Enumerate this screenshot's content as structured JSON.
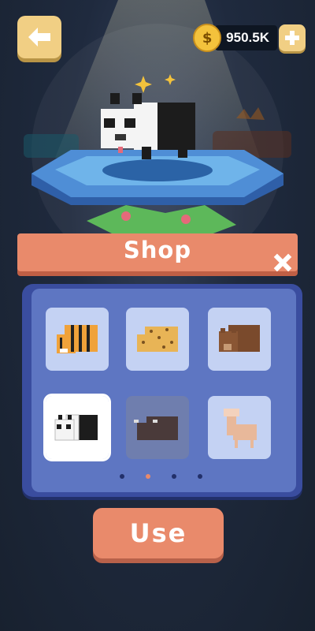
{
  "header": {
    "back_icon": "arrow-left-icon",
    "coin_symbol": "$",
    "coin_amount": "950.5K",
    "add_coins_icon": "plus-icon"
  },
  "shop": {
    "title": "Shop",
    "close_icon": "close-icon",
    "animals": [
      {
        "name": "tiger",
        "state": "unlocked"
      },
      {
        "name": "leopard",
        "state": "unlocked"
      },
      {
        "name": "bear",
        "state": "unlocked"
      },
      {
        "name": "panda",
        "state": "selected"
      },
      {
        "name": "yak",
        "state": "locked"
      },
      {
        "name": "alpaca",
        "state": "unlocked"
      }
    ],
    "pages": 4,
    "current_page": 2
  },
  "use_button": {
    "label": "Use"
  },
  "colors": {
    "accent": "#e98a6b",
    "panel": "#3a4d9f",
    "gold": "#f1cf84"
  }
}
